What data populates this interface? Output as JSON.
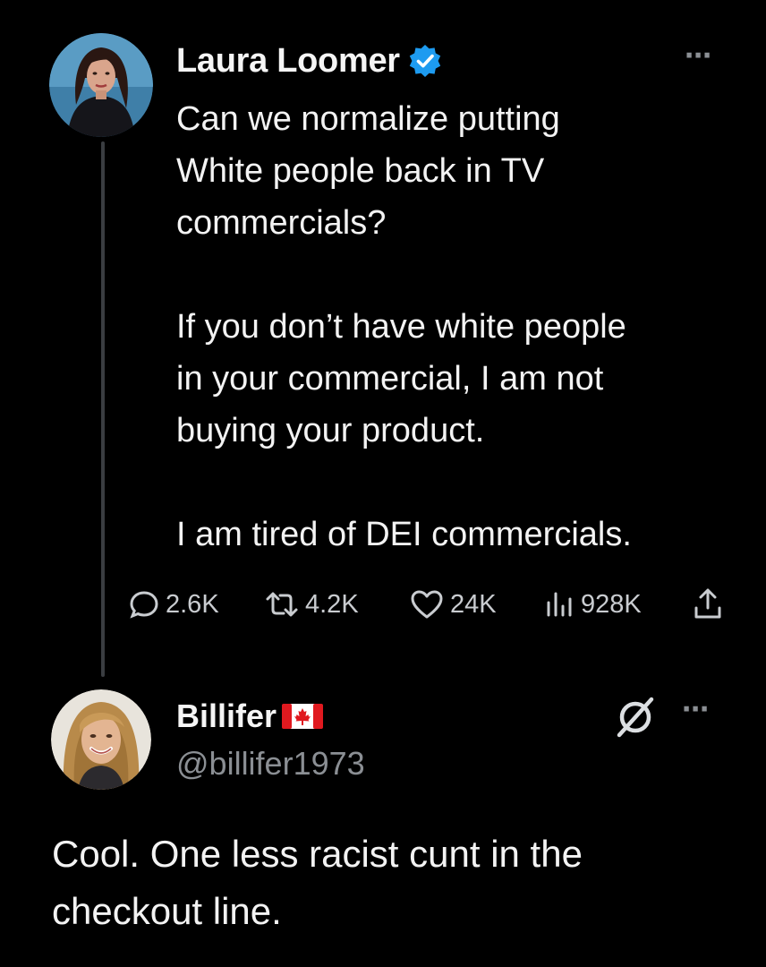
{
  "tweet": {
    "author": {
      "display_name": "Laura Loomer",
      "verified": true,
      "avatar": "woman-dark-hair-avatar"
    },
    "text": {
      "line1": "Can we normalize putting",
      "line2": "White people back in TV",
      "line3": "commercials?",
      "line4": "If you don’t have white people",
      "line5": "in your commercial, I am not",
      "line6": "buying your product.",
      "line7": "I am tired of DEI commercials."
    },
    "metrics": {
      "replies": "2.6K",
      "reposts": "4.2K",
      "likes": "24K",
      "views": "928K"
    },
    "more_icon": "⋯"
  },
  "reply": {
    "author": {
      "display_name": "Billifer",
      "flag": "canada-flag",
      "handle": "@billifer1973",
      "avatar": "woman-blonde-hair-avatar"
    },
    "text": {
      "line1": "Cool. One less racist cunt in the",
      "line2": "checkout line."
    },
    "more_icon": "⋯"
  },
  "colors": {
    "background": "#000000",
    "text": "#f3f3f3",
    "muted": "#8b8f94",
    "verified": "#1d9bf0",
    "flag_red": "#e0191f"
  }
}
